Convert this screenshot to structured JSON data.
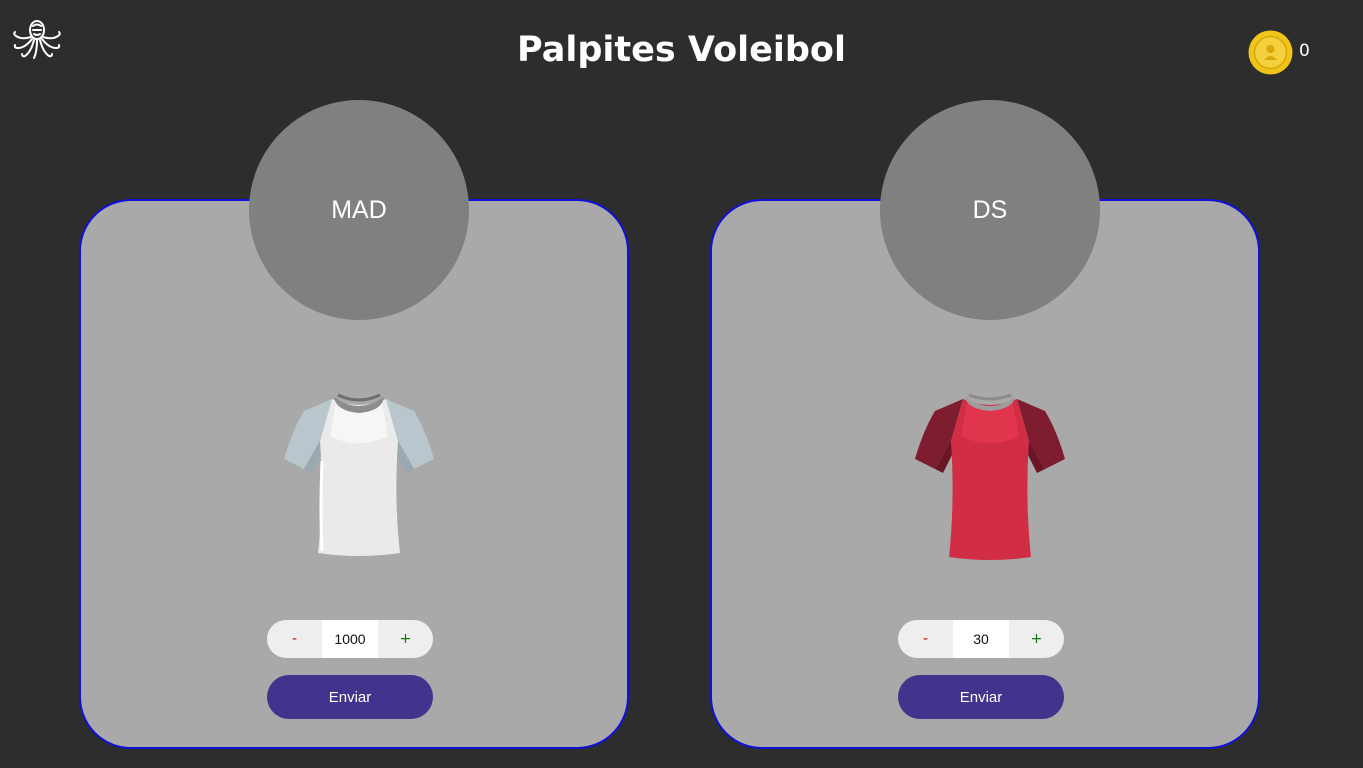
{
  "header": {
    "title": "Palpites Voleibol",
    "coin_icon": "gold-coin-icon",
    "coin_count": "0",
    "logo_icon": "octopus-logo-icon"
  },
  "colors": {
    "background": "#2d2d2d",
    "card": "#a9a9a9",
    "card_border": "#1010d8",
    "team_circle": "#808080",
    "send_button": "#42348c",
    "coin": "#f0c419"
  },
  "teams": [
    {
      "abbr": "MAD",
      "shirt_icon": "white-shirt-icon",
      "minus_label": "-",
      "bet_value": "1000",
      "plus_label": "+",
      "send_label": "Enviar"
    },
    {
      "abbr": "DS",
      "shirt_icon": "red-shirt-icon",
      "minus_label": "-",
      "bet_value": "30",
      "plus_label": "+",
      "send_label": "Enviar"
    }
  ]
}
